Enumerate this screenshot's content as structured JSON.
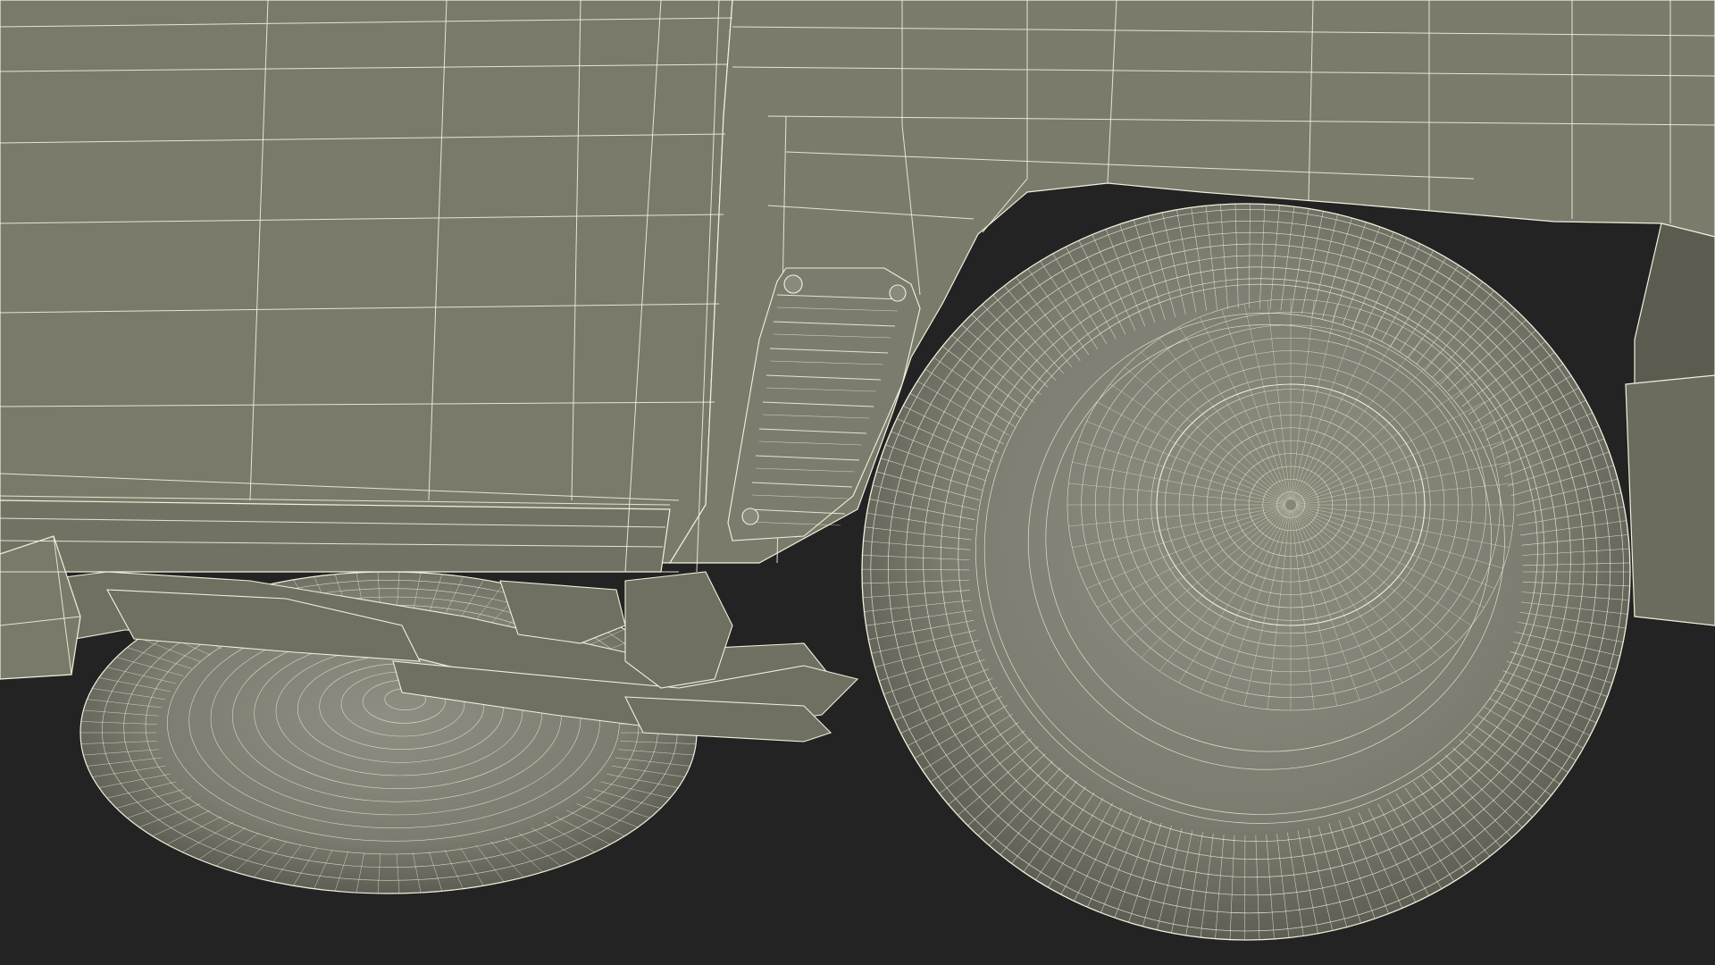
{
  "colors": {
    "background": "#232323",
    "body_panel": "#7a7a6a",
    "body_panel_dark": "#6b6b5c",
    "shadow": "#4a4a40",
    "wire": "#f2f0dc",
    "tire": "#85857a",
    "hub": "#8a8a7c"
  }
}
